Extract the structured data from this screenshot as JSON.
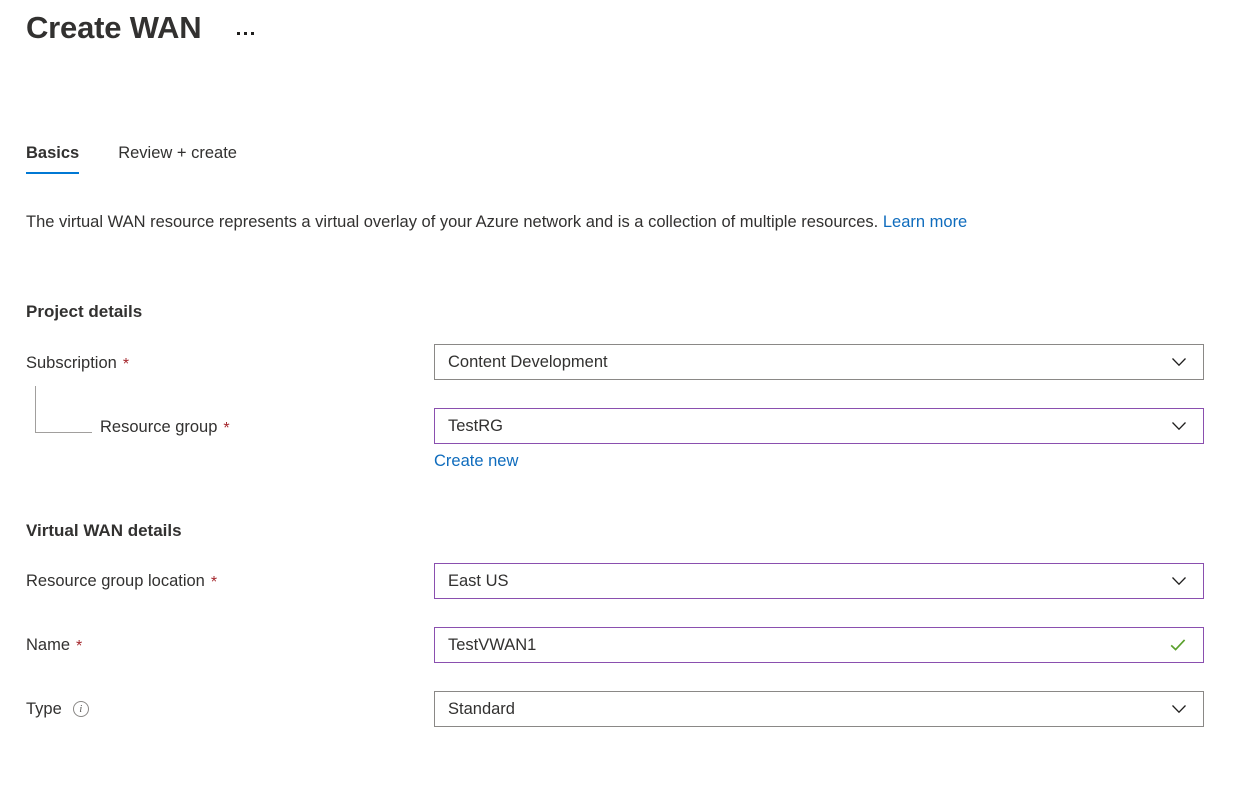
{
  "header": {
    "title": "Create WAN",
    "more_menu": "…"
  },
  "tabs": [
    {
      "label": "Basics",
      "active": true
    },
    {
      "label": "Review + create",
      "active": false
    }
  ],
  "description": {
    "text": "The virtual WAN resource represents a virtual overlay of your Azure network and is a collection of multiple resources.",
    "link_text": "Learn more"
  },
  "sections": {
    "project_details": {
      "heading": "Project details",
      "fields": {
        "subscription": {
          "label": "Subscription",
          "required": "*",
          "value": "Content Development",
          "control": "dropdown",
          "state": "normal"
        },
        "resource_group": {
          "label": "Resource group",
          "required": "*",
          "value": "TestRG",
          "control": "dropdown",
          "state": "focused",
          "action_link": "Create new"
        }
      }
    },
    "virtual_wan_details": {
      "heading": "Virtual WAN details",
      "fields": {
        "resource_group_location": {
          "label": "Resource group location",
          "required": "*",
          "value": "East US",
          "control": "dropdown",
          "state": "focused"
        },
        "name": {
          "label": "Name",
          "required": "*",
          "value": "TestVWAN1",
          "control": "textbox",
          "state": "focused",
          "validation": "valid"
        },
        "type": {
          "label": "Type",
          "info": "i",
          "value": "Standard",
          "control": "dropdown",
          "state": "normal"
        }
      }
    }
  },
  "colors": {
    "accent_blue": "#0078d4",
    "link_blue": "#0f6cbd",
    "required_red": "#a4262c",
    "focus_purple": "#8a4faf",
    "border_gray": "#8a8886",
    "valid_green": "#5aa02c",
    "text": "#323130"
  }
}
